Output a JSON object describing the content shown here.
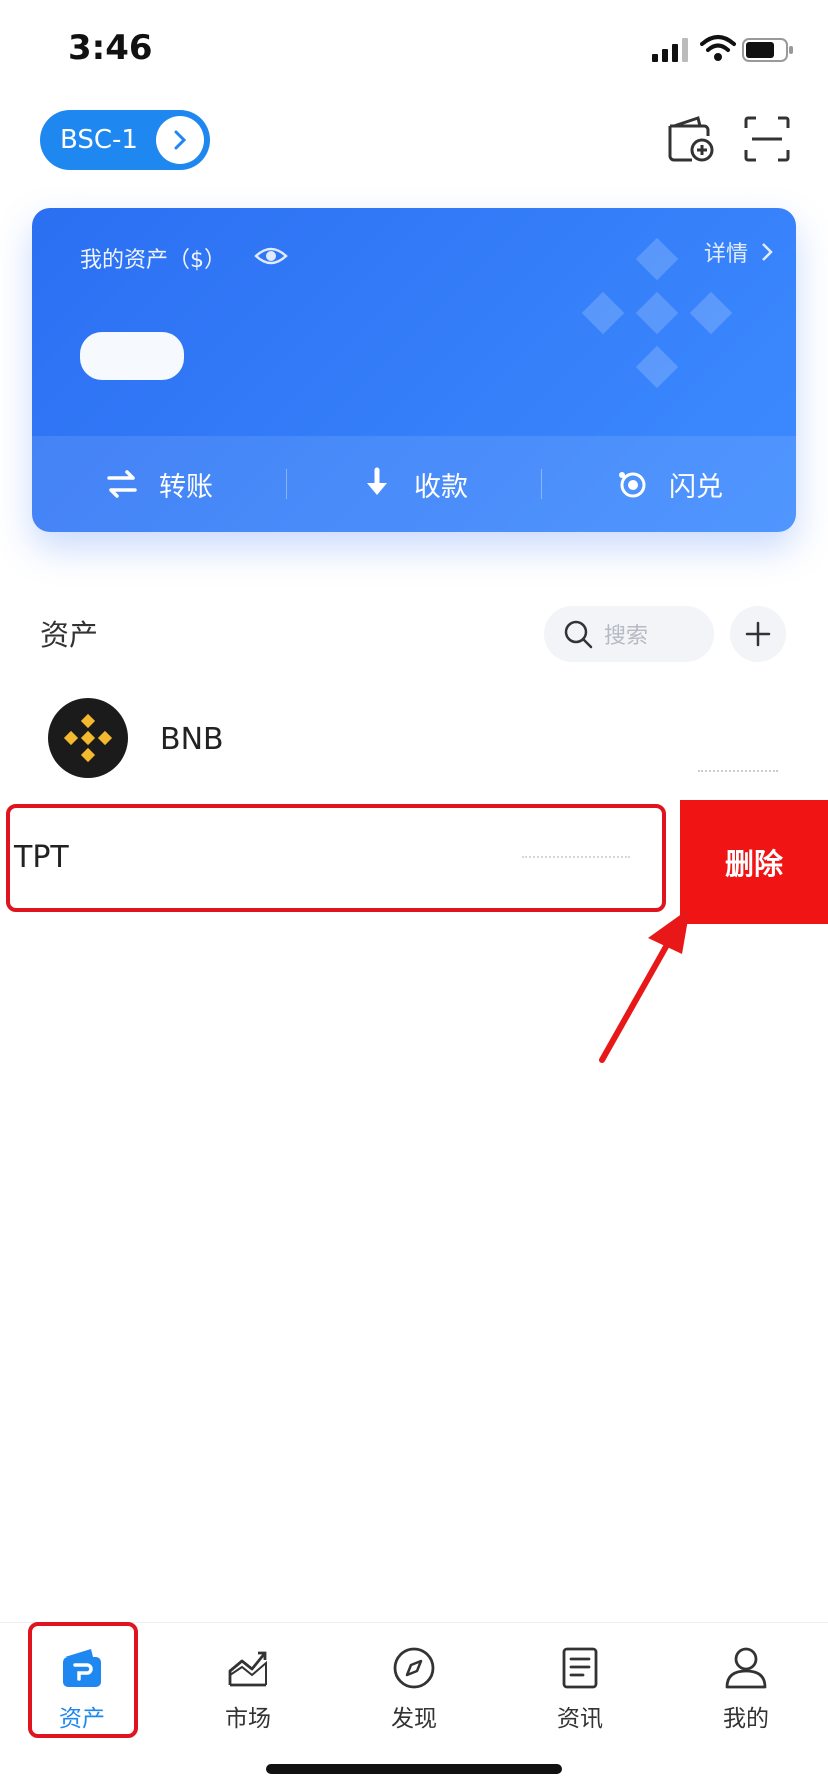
{
  "status_bar": {
    "time": "3:46"
  },
  "header": {
    "wallet_name": "BSC-1"
  },
  "asset_card": {
    "title": "我的资产（$）",
    "detail_label": "详情",
    "balance": "****",
    "actions": [
      {
        "label": "转账",
        "icon": "transfer-icon"
      },
      {
        "label": "收款",
        "icon": "receive-icon"
      },
      {
        "label": "闪兑",
        "icon": "swap-icon"
      }
    ]
  },
  "assets": {
    "section_title": "资产",
    "search_placeholder": "搜索",
    "tokens": [
      {
        "symbol": "BNB"
      },
      {
        "symbol": "TPT"
      }
    ],
    "delete_label": "删除"
  },
  "tab_bar": {
    "items": [
      {
        "label": "资产",
        "icon": "wallet-icon",
        "active": true
      },
      {
        "label": "市场",
        "icon": "market-chart-icon",
        "active": false
      },
      {
        "label": "发现",
        "icon": "compass-icon",
        "active": false
      },
      {
        "label": "资讯",
        "icon": "news-icon",
        "active": false
      },
      {
        "label": "我的",
        "icon": "profile-icon",
        "active": false
      }
    ]
  },
  "colors": {
    "primary": "#1e87f0",
    "card_gradient_start": "#2b6ff2",
    "card_gradient_end": "#3d8bff",
    "delete_red": "#f01414",
    "highlight_red": "#e0141e",
    "bnb_yellow": "#f3ba2f"
  }
}
